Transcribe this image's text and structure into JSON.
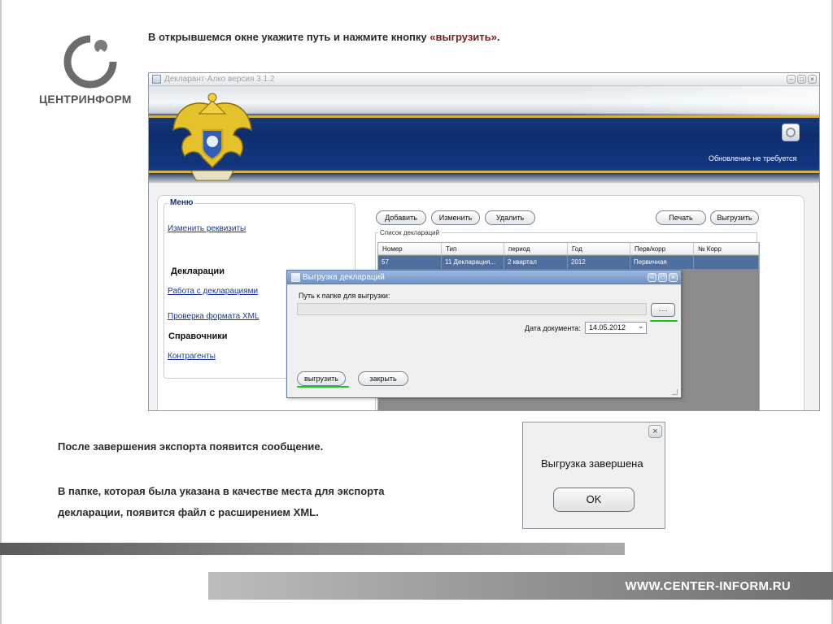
{
  "slide": {
    "logo_text": "ЦЕНТРИНФОРМ",
    "heading_prefix": "В открывшемся окне укажите путь и нажмите кнопку ",
    "heading_highlight": "«выгрузить»",
    "heading_suffix": ".",
    "text_after_export": "После завершения экспорта появится сообщение.",
    "text_xml_line1": "В папке, которая была указана в качестве места для экспорта",
    "text_xml_line2": "декларации, появится файл с расширением XML.",
    "footer_url": "WWW.CENTER-INFORM.RU"
  },
  "app": {
    "title": "Декларант-Алко версия 3.1.2",
    "update_status": "Обновление не требуется",
    "menu": {
      "legend": "Меню",
      "edit_requisites": "Изменить реквизиты",
      "declarations_heading": "Декларации",
      "work_with_declarations": "Работа с декларациями",
      "check_xml_format": "Проверка формата XML",
      "references_heading": "Справочники",
      "counterparties": "Контрагенты"
    },
    "toolbar": {
      "add": "Добавить",
      "edit": "Изменить",
      "delete": "Удалить",
      "print": "Печать",
      "export": "Выгрузить"
    },
    "list": {
      "legend": "Список деклараций",
      "columns": [
        "Номер",
        "Тип",
        "период",
        "Год",
        "Перв/корр",
        "№ Корр"
      ],
      "rows": [
        [
          "57",
          "11 Декларация...",
          "2 квартал",
          "2012",
          "Первичная",
          ""
        ]
      ]
    }
  },
  "export_dialog": {
    "title": "Выгрузка деклараций",
    "path_label": "Путь к папке для выгрузки:",
    "path_value": "",
    "browse_label": ".....",
    "date_label": "Дата документа:",
    "date_value": "14.05.2012",
    "export_button": "выгрузить",
    "close_button": "закрыть",
    "highlight_color": "#19c519"
  },
  "message_box": {
    "text": "Выгрузка завершена",
    "ok_label": "OK"
  },
  "colors": {
    "heading_highlight": "#7a1b1b",
    "banner_blue": "#0e2d6e",
    "link": "#15379a",
    "selected_row": "#4f6f9f"
  }
}
